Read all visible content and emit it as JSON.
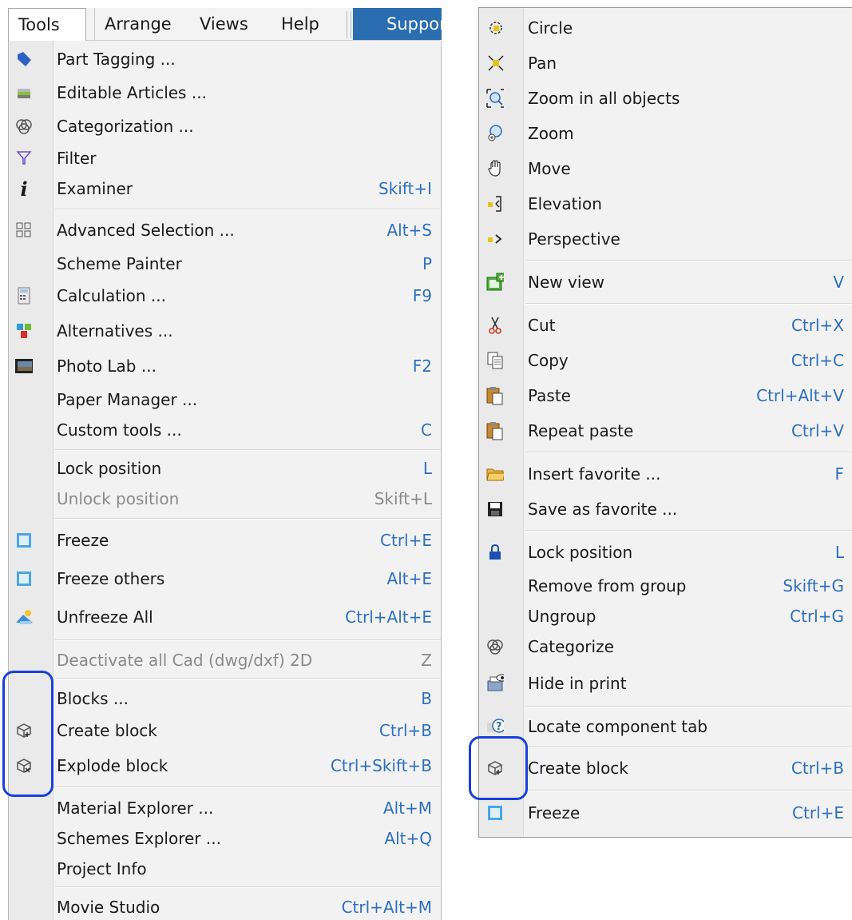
{
  "menubar": {
    "tools": "Tools",
    "arrange": "Arrange",
    "views": "Views",
    "help": "Help",
    "support": "Suppor"
  },
  "left_menu": [
    {
      "label": "Part Tagging ...",
      "shortcut": "",
      "icon": "tag-icon"
    },
    {
      "label": "Editable Articles ...",
      "shortcut": "",
      "icon": "articles-icon"
    },
    {
      "label": "Categorization ...",
      "shortcut": "",
      "icon": "categorize-icon"
    },
    {
      "label": "Filter",
      "shortcut": "",
      "icon": "filter-icon"
    },
    {
      "label": "Examiner",
      "shortcut": "Skift+I",
      "icon": "info-icon"
    },
    {
      "label": "Advanced Selection ...",
      "shortcut": "Alt+S",
      "icon": "selection-grid-icon"
    },
    {
      "label": "Scheme Painter",
      "shortcut": "P",
      "icon": ""
    },
    {
      "label": "Calculation ...",
      "shortcut": "F9",
      "icon": "calculator-icon"
    },
    {
      "label": "Alternatives ...",
      "shortcut": "",
      "icon": "alternatives-icon"
    },
    {
      "label": "Photo Lab ...",
      "shortcut": "F2",
      "icon": "photo-icon"
    },
    {
      "label": "Paper Manager ...",
      "shortcut": "",
      "icon": ""
    },
    {
      "label": "Custom tools ...",
      "shortcut": "C",
      "icon": ""
    },
    {
      "label": "Lock position",
      "shortcut": "L",
      "icon": ""
    },
    {
      "label": "Unlock position",
      "shortcut": "Skift+L",
      "icon": "",
      "disabled": true
    },
    {
      "label": "Freeze",
      "shortcut": "Ctrl+E",
      "icon": "freeze-icon"
    },
    {
      "label": "Freeze others",
      "shortcut": "Alt+E",
      "icon": "freeze-others-icon"
    },
    {
      "label": "Unfreeze All",
      "shortcut": "Ctrl+Alt+E",
      "icon": "unfreeze-icon"
    },
    {
      "label": "Deactivate all Cad (dwg/dxf) 2D",
      "shortcut": "Z",
      "icon": "",
      "disabled": true
    },
    {
      "label": "Blocks ...",
      "shortcut": "B",
      "icon": ""
    },
    {
      "label": "Create block",
      "shortcut": "Ctrl+B",
      "icon": "create-block-icon"
    },
    {
      "label": "Explode block",
      "shortcut": "Ctrl+Skift+B",
      "icon": "explode-block-icon"
    },
    {
      "label": "Material Explorer ...",
      "shortcut": "Alt+M",
      "icon": ""
    },
    {
      "label": "Schemes Explorer ...",
      "shortcut": "Alt+Q",
      "icon": ""
    },
    {
      "label": "Project Info",
      "shortcut": "",
      "icon": ""
    },
    {
      "label": "Movie Studio",
      "shortcut": "Ctrl+Alt+M",
      "icon": ""
    }
  ],
  "right_menu": [
    {
      "label": "Circle",
      "shortcut": "",
      "icon": "circle-icon"
    },
    {
      "label": "Pan",
      "shortcut": "",
      "icon": "pan-icon"
    },
    {
      "label": "Zoom in all objects",
      "shortcut": "",
      "icon": "zoom-all-icon"
    },
    {
      "label": "Zoom",
      "shortcut": "",
      "icon": "zoom-icon"
    },
    {
      "label": "Move",
      "shortcut": "",
      "icon": "hand-icon"
    },
    {
      "label": "Elevation",
      "shortcut": "",
      "icon": "elevation-icon"
    },
    {
      "label": "Perspective",
      "shortcut": "",
      "icon": "perspective-icon"
    },
    {
      "label": "New view",
      "shortcut": "V",
      "icon": "new-view-icon"
    },
    {
      "label": "Cut",
      "shortcut": "Ctrl+X",
      "icon": "scissors-icon"
    },
    {
      "label": "Copy",
      "shortcut": "Ctrl+C",
      "icon": "copy-icon"
    },
    {
      "label": "Paste",
      "shortcut": "Ctrl+Alt+V",
      "icon": "paste-icon"
    },
    {
      "label": "Repeat paste",
      "shortcut": "Ctrl+V",
      "icon": "repeat-paste-icon"
    },
    {
      "label": "Insert favorite ...",
      "shortcut": "F",
      "icon": "folder-icon"
    },
    {
      "label": "Save as favorite ...",
      "shortcut": "",
      "icon": "save-icon"
    },
    {
      "label": "Lock position",
      "shortcut": "L",
      "icon": "lock-icon"
    },
    {
      "label": "Remove from group",
      "shortcut": "Skift+G",
      "icon": ""
    },
    {
      "label": "Ungroup",
      "shortcut": "Ctrl+G",
      "icon": ""
    },
    {
      "label": "Categorize",
      "shortcut": "",
      "icon": "categorize-icon"
    },
    {
      "label": "Hide in print",
      "shortcut": "",
      "icon": "hide-print-icon"
    },
    {
      "label": "Locate component tab",
      "shortcut": "",
      "icon": "help-icon"
    },
    {
      "label": "Create block",
      "shortcut": "Ctrl+B",
      "icon": "create-block-icon"
    },
    {
      "label": "Freeze",
      "shortcut": "Ctrl+E",
      "icon": "freeze-icon"
    }
  ],
  "colors": {
    "accent": "#2a6db0",
    "shortcut": "#2d6fc1",
    "highlight": "#1a3fdc"
  }
}
